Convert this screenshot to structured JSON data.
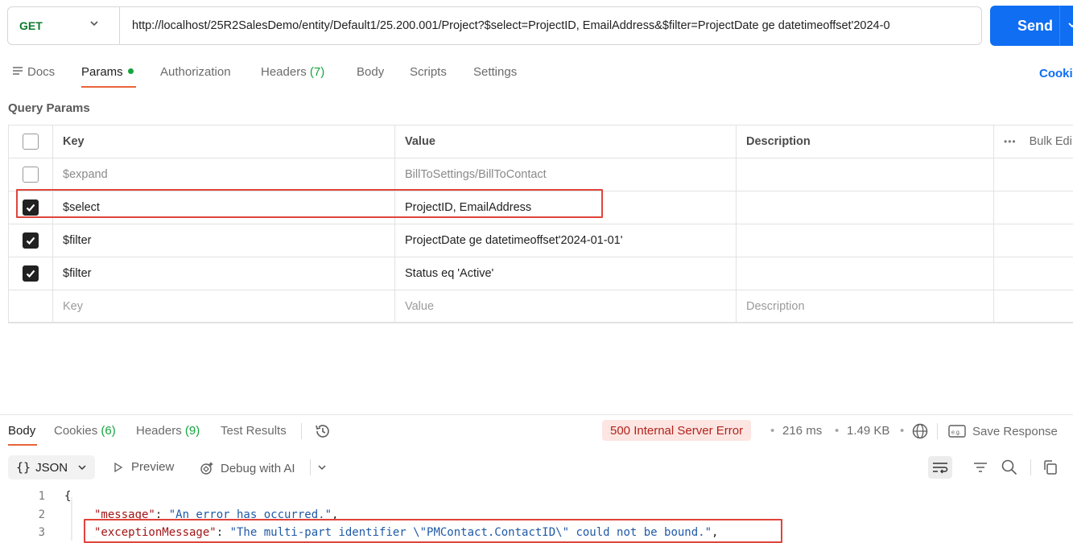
{
  "request": {
    "method": "GET",
    "url": "http://localhost/25R2SalesDemo/entity/Default1/25.200.001/Project?$select=ProjectID, EmailAddress&$filter=ProjectDate ge datetimeoffset'2024-0",
    "send_label": "Send"
  },
  "request_tabs": {
    "docs": "Docs",
    "params": "Params",
    "authorization": "Authorization",
    "headers": "Headers",
    "headers_count": "(7)",
    "body": "Body",
    "scripts": "Scripts",
    "settings": "Settings",
    "cookies": "Cooki"
  },
  "query_params": {
    "title": "Query Params",
    "headers": {
      "key": "Key",
      "value": "Value",
      "description": "Description",
      "bulk_edit": "Bulk Edi"
    },
    "rows": [
      {
        "checked": false,
        "key": "$expand",
        "value": "BillToSettings/BillToContact",
        "description": ""
      },
      {
        "checked": true,
        "key": "$select",
        "value": "ProjectID, EmailAddress",
        "description": ""
      },
      {
        "checked": true,
        "key": "$filter",
        "value": "ProjectDate ge datetimeoffset'2024-01-01'",
        "description": ""
      },
      {
        "checked": true,
        "key": "$filter",
        "value": "Status eq 'Active'",
        "description": ""
      }
    ],
    "new_row": {
      "key_placeholder": "Key",
      "value_placeholder": "Value",
      "description_placeholder": "Description"
    }
  },
  "response": {
    "tabs": {
      "body": "Body",
      "cookies": "Cookies",
      "cookies_count": "(6)",
      "headers": "Headers",
      "headers_count": "(9)",
      "test_results": "Test Results"
    },
    "status": "500 Internal Server Error",
    "time": "216 ms",
    "size": "1.49 KB",
    "save_response": "Save Response",
    "format": "JSON",
    "preview": "Preview",
    "debug_ai": "Debug with AI",
    "code_lines": [
      {
        "num": "1",
        "open": "{"
      },
      {
        "num": "2",
        "key": "\"message\"",
        "sep": ": ",
        "val": "\"An error has occurred.\"",
        "end": ","
      },
      {
        "num": "3",
        "key": "\"exceptionMessage\"",
        "sep": ": ",
        "val": "\"The multi-part identifier \\\"PMContact.ContactID\\\" could not be bound.\"",
        "end": ","
      }
    ]
  },
  "colors": {
    "accent": "#0f6ef2",
    "method_get": "#0c7a2d",
    "active_tab_underline": "#e8633a",
    "error_badge_bg": "#fde5e2",
    "error_text": "#b0241b",
    "highlight_box": "#e0443b"
  }
}
